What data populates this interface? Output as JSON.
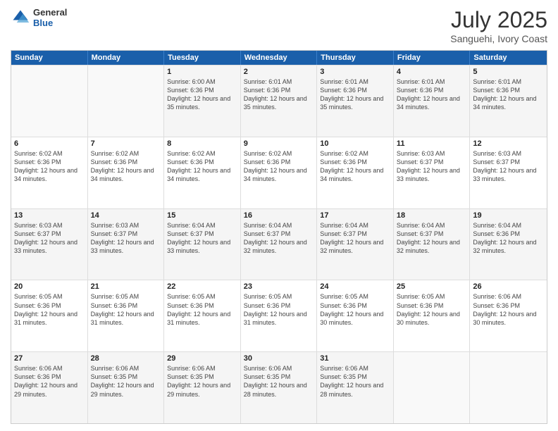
{
  "header": {
    "logo": {
      "general": "General",
      "blue": "Blue"
    },
    "title": "July 2025",
    "subtitle": "Sanguehi, Ivory Coast"
  },
  "calendar": {
    "days_of_week": [
      "Sunday",
      "Monday",
      "Tuesday",
      "Wednesday",
      "Thursday",
      "Friday",
      "Saturday"
    ],
    "weeks": [
      [
        {
          "day": "",
          "empty": true
        },
        {
          "day": "",
          "empty": true
        },
        {
          "day": "1",
          "sunrise": "6:00 AM",
          "sunset": "6:36 PM",
          "daylight": "12 hours and 35 minutes."
        },
        {
          "day": "2",
          "sunrise": "6:01 AM",
          "sunset": "6:36 PM",
          "daylight": "12 hours and 35 minutes."
        },
        {
          "day": "3",
          "sunrise": "6:01 AM",
          "sunset": "6:36 PM",
          "daylight": "12 hours and 35 minutes."
        },
        {
          "day": "4",
          "sunrise": "6:01 AM",
          "sunset": "6:36 PM",
          "daylight": "12 hours and 34 minutes."
        },
        {
          "day": "5",
          "sunrise": "6:01 AM",
          "sunset": "6:36 PM",
          "daylight": "12 hours and 34 minutes."
        }
      ],
      [
        {
          "day": "6",
          "sunrise": "6:02 AM",
          "sunset": "6:36 PM",
          "daylight": "12 hours and 34 minutes."
        },
        {
          "day": "7",
          "sunrise": "6:02 AM",
          "sunset": "6:36 PM",
          "daylight": "12 hours and 34 minutes."
        },
        {
          "day": "8",
          "sunrise": "6:02 AM",
          "sunset": "6:36 PM",
          "daylight": "12 hours and 34 minutes."
        },
        {
          "day": "9",
          "sunrise": "6:02 AM",
          "sunset": "6:36 PM",
          "daylight": "12 hours and 34 minutes."
        },
        {
          "day": "10",
          "sunrise": "6:02 AM",
          "sunset": "6:36 PM",
          "daylight": "12 hours and 34 minutes."
        },
        {
          "day": "11",
          "sunrise": "6:03 AM",
          "sunset": "6:37 PM",
          "daylight": "12 hours and 33 minutes."
        },
        {
          "day": "12",
          "sunrise": "6:03 AM",
          "sunset": "6:37 PM",
          "daylight": "12 hours and 33 minutes."
        }
      ],
      [
        {
          "day": "13",
          "sunrise": "6:03 AM",
          "sunset": "6:37 PM",
          "daylight": "12 hours and 33 minutes."
        },
        {
          "day": "14",
          "sunrise": "6:03 AM",
          "sunset": "6:37 PM",
          "daylight": "12 hours and 33 minutes."
        },
        {
          "day": "15",
          "sunrise": "6:04 AM",
          "sunset": "6:37 PM",
          "daylight": "12 hours and 33 minutes."
        },
        {
          "day": "16",
          "sunrise": "6:04 AM",
          "sunset": "6:37 PM",
          "daylight": "12 hours and 32 minutes."
        },
        {
          "day": "17",
          "sunrise": "6:04 AM",
          "sunset": "6:37 PM",
          "daylight": "12 hours and 32 minutes."
        },
        {
          "day": "18",
          "sunrise": "6:04 AM",
          "sunset": "6:37 PM",
          "daylight": "12 hours and 32 minutes."
        },
        {
          "day": "19",
          "sunrise": "6:04 AM",
          "sunset": "6:36 PM",
          "daylight": "12 hours and 32 minutes."
        }
      ],
      [
        {
          "day": "20",
          "sunrise": "6:05 AM",
          "sunset": "6:36 PM",
          "daylight": "12 hours and 31 minutes."
        },
        {
          "day": "21",
          "sunrise": "6:05 AM",
          "sunset": "6:36 PM",
          "daylight": "12 hours and 31 minutes."
        },
        {
          "day": "22",
          "sunrise": "6:05 AM",
          "sunset": "6:36 PM",
          "daylight": "12 hours and 31 minutes."
        },
        {
          "day": "23",
          "sunrise": "6:05 AM",
          "sunset": "6:36 PM",
          "daylight": "12 hours and 31 minutes."
        },
        {
          "day": "24",
          "sunrise": "6:05 AM",
          "sunset": "6:36 PM",
          "daylight": "12 hours and 30 minutes."
        },
        {
          "day": "25",
          "sunrise": "6:05 AM",
          "sunset": "6:36 PM",
          "daylight": "12 hours and 30 minutes."
        },
        {
          "day": "26",
          "sunrise": "6:06 AM",
          "sunset": "6:36 PM",
          "daylight": "12 hours and 30 minutes."
        }
      ],
      [
        {
          "day": "27",
          "sunrise": "6:06 AM",
          "sunset": "6:36 PM",
          "daylight": "12 hours and 29 minutes."
        },
        {
          "day": "28",
          "sunrise": "6:06 AM",
          "sunset": "6:35 PM",
          "daylight": "12 hours and 29 minutes."
        },
        {
          "day": "29",
          "sunrise": "6:06 AM",
          "sunset": "6:35 PM",
          "daylight": "12 hours and 29 minutes."
        },
        {
          "day": "30",
          "sunrise": "6:06 AM",
          "sunset": "6:35 PM",
          "daylight": "12 hours and 28 minutes."
        },
        {
          "day": "31",
          "sunrise": "6:06 AM",
          "sunset": "6:35 PM",
          "daylight": "12 hours and 28 minutes."
        },
        {
          "day": "",
          "empty": true
        },
        {
          "day": "",
          "empty": true
        }
      ]
    ]
  }
}
